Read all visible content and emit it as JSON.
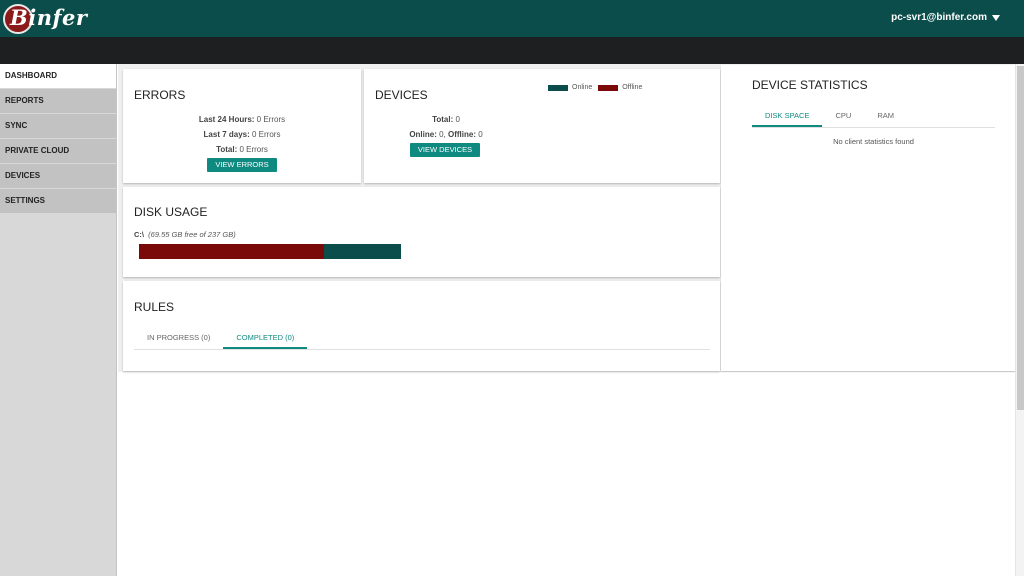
{
  "header": {
    "logo_text": "Binfer",
    "user": "pc-svr1@binfer.com"
  },
  "sidebar": {
    "items": [
      {
        "label": "DASHBOARD",
        "active": true
      },
      {
        "label": "REPORTS"
      },
      {
        "label": "SYNC"
      },
      {
        "label": "PRIVATE CLOUD"
      },
      {
        "label": "DEVICES"
      },
      {
        "label": "SETTINGS"
      }
    ]
  },
  "errors": {
    "title": "ERRORS",
    "last24_label": "Last 24 Hours:",
    "last24_value": " 0 Errors",
    "last7_label": "Last 7 days:",
    "last7_value": " 0 Errors",
    "total_label": "Total:",
    "total_value": " 0 Errors",
    "button": "VIEW ERRORS"
  },
  "devices": {
    "title": "DEVICES",
    "legend": [
      {
        "label": "Online",
        "color": "#0b4d4a"
      },
      {
        "label": "Offline",
        "color": "#7a0a0a"
      }
    ],
    "total_label": "Total:",
    "total_value": " 0",
    "online_label": "Online:",
    "online_value": " 0, ",
    "offline_label": "Offline:",
    "offline_value": " 0",
    "button": "VIEW DEVICES"
  },
  "disk_usage": {
    "title": "DISK USAGE",
    "drive": "C:\\",
    "detail": "(69.55 GB free of 237 GB)",
    "used_fraction": 0.7065,
    "used_color": "#7a0a0a",
    "free_color": "#0b4d4a"
  },
  "rules": {
    "title": "RULES",
    "tabs": [
      {
        "label": "IN PROGRESS (0)"
      },
      {
        "label": "COMPLETED (0)",
        "active": true
      }
    ]
  },
  "device_statistics": {
    "title": "DEVICE STATISTICS",
    "tabs": [
      {
        "label": "DISK SPACE",
        "active": true
      },
      {
        "label": "CPU"
      },
      {
        "label": "RAM"
      }
    ],
    "empty_message": "No client statistics found"
  },
  "colors": {
    "header": "#0b4d4a",
    "accent": "#0f8a81",
    "dark_bar": "#1e1f20"
  }
}
